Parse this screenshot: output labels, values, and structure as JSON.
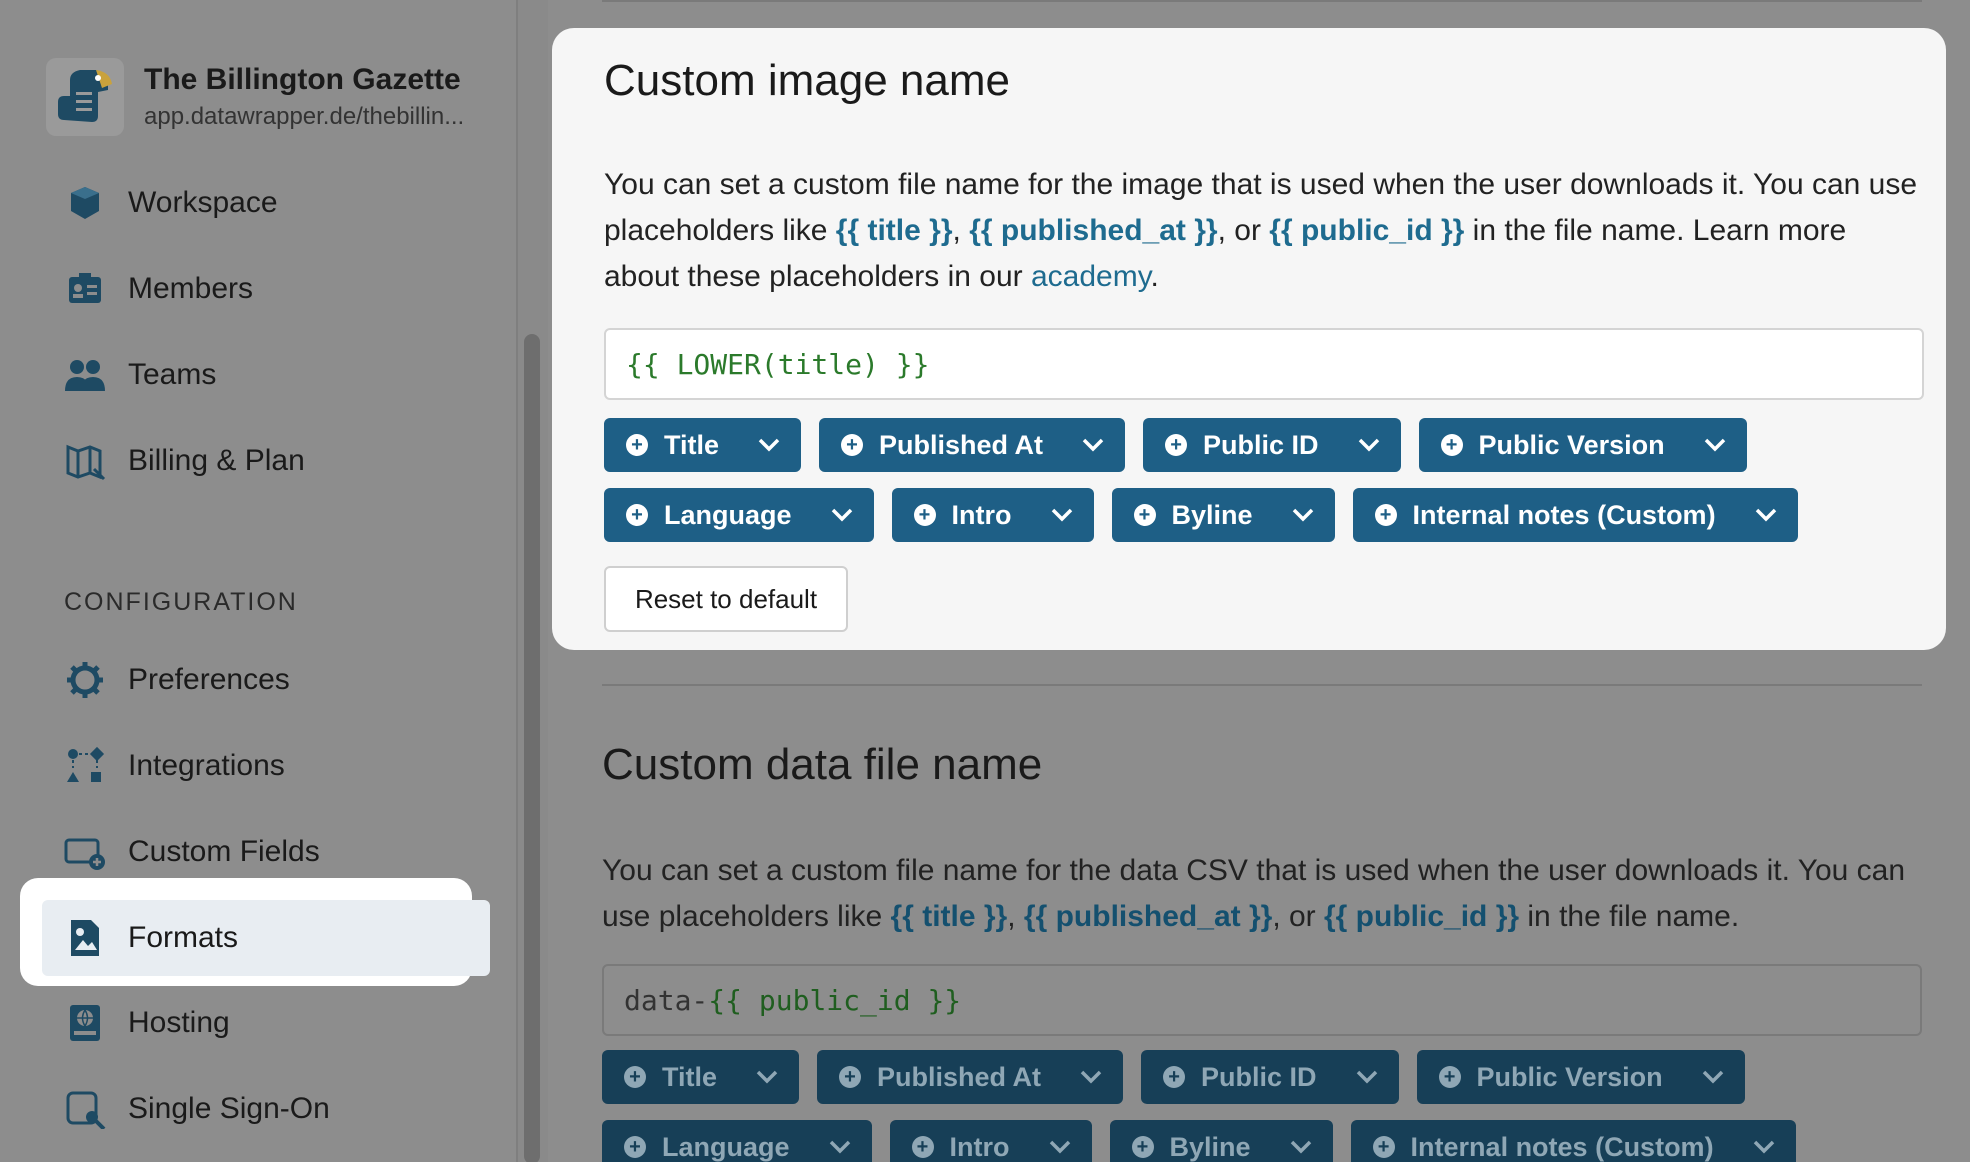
{
  "org": {
    "name": "The Billington Gazette",
    "url": "app.datawrapper.de/thebillin..."
  },
  "nav": {
    "items": [
      {
        "label": "Workspace",
        "icon": "workspace-icon"
      },
      {
        "label": "Members",
        "icon": "members-icon"
      },
      {
        "label": "Teams",
        "icon": "teams-icon"
      },
      {
        "label": "Billing & Plan",
        "icon": "billing-icon"
      }
    ],
    "config_label": "CONFIGURATION",
    "config_items": [
      {
        "label": "Preferences",
        "icon": "gear-icon"
      },
      {
        "label": "Integrations",
        "icon": "integrations-icon"
      },
      {
        "label": "Custom Fields",
        "icon": "custom-fields-icon"
      },
      {
        "label": "Formats",
        "icon": "image-icon",
        "active": true
      },
      {
        "label": "Hosting",
        "icon": "hosting-icon"
      },
      {
        "label": "Single Sign-On",
        "icon": "sso-icon"
      }
    ]
  },
  "image_section": {
    "title": "Custom image name",
    "desc_1": "You can set a custom file name for the image that is used when the user downloads it. You can use placeholders like ",
    "ph_title": "{{ title }}",
    "sep1": ", ",
    "ph_published": "{{ published_at }}",
    "sep2": ", or ",
    "ph_public": "{{ public_id }}",
    "desc_2": " in the file name. Learn more about these placeholders in our ",
    "link": "academy",
    "desc_end": ".",
    "input_value": "{{ LOWER(title) }}",
    "pills_row1": [
      "Title",
      "Published At",
      "Public ID",
      "Public Version"
    ],
    "pills_row2": [
      "Language",
      "Intro",
      "Byline",
      "Internal notes (Custom)"
    ],
    "reset_label": "Reset to default"
  },
  "data_section": {
    "title": "Custom data file name",
    "desc_1": "You can set a custom file name for the data CSV that is used when the user downloads it. You can use placeholders like ",
    "ph_title": "{{ title }}",
    "sep1": ", ",
    "ph_published": "{{ published_at }}",
    "sep2": ", or ",
    "ph_public": "{{ public_id }}",
    "desc_2": " in the file name.",
    "input_prefix": "data-",
    "input_placeholder": "{{ public_id }}",
    "pills_row1": [
      "Title",
      "Published At",
      "Public ID",
      "Public Version"
    ],
    "pills_row2": [
      "Language",
      "Intro",
      "Byline",
      "Internal notes (Custom)"
    ]
  },
  "colors": {
    "accent": "#1e5f86",
    "link": "#1e6b8f",
    "code": "#2b7a2b"
  }
}
